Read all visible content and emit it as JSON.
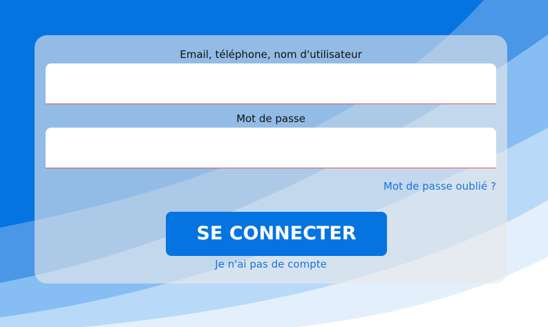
{
  "colors": {
    "background_primary": "#0674e0",
    "accent": "#0674e0",
    "link": "#1a73d9",
    "input_underline": "#e0555a"
  },
  "login": {
    "identifier_label": "Email, téléphone, nom d'utilisateur",
    "identifier_value": "",
    "password_label": "Mot de passe",
    "password_value": "",
    "forgot_link": "Mot de passe oublié ?",
    "submit_label": "SE CONNECTER",
    "no_account_link": "Je n'ai pas de compte"
  }
}
